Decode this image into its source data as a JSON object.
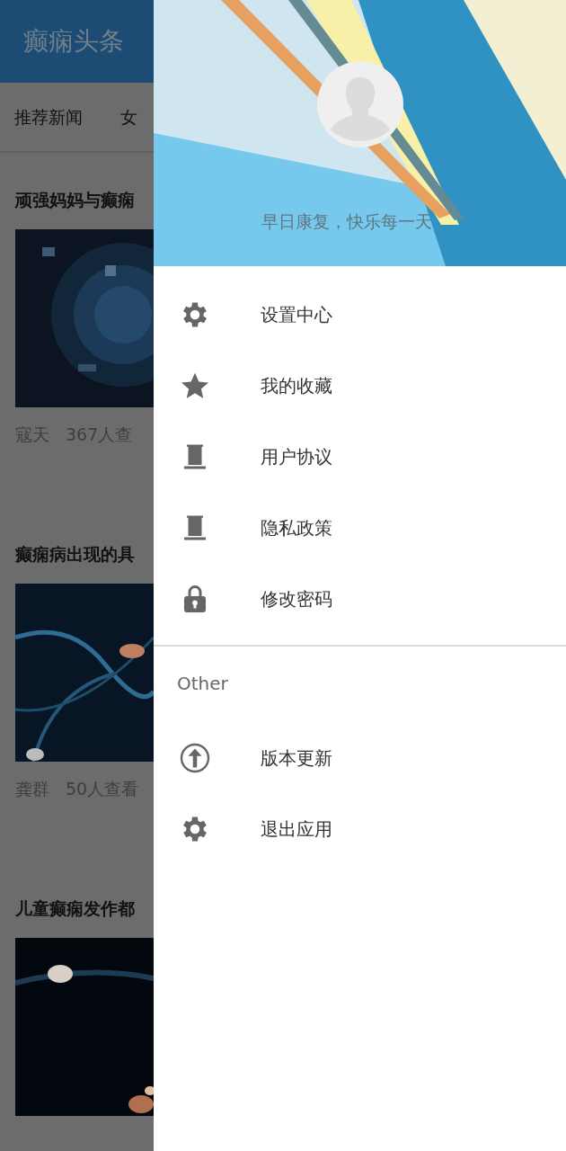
{
  "app_bar": {
    "title": "癫痫头条"
  },
  "tabs": [
    {
      "label": "推荐新闻"
    },
    {
      "label": "女"
    }
  ],
  "articles": [
    {
      "title": "顽强妈妈与癫痫",
      "author": "寇天",
      "views": "367人查"
    },
    {
      "title": "癫痫病出现的具",
      "author": "龚群",
      "views": "50人查看"
    },
    {
      "title": "儿童癫痫发作都"
    }
  ],
  "drawer": {
    "header": {
      "motto": "早日康复，快乐每一天"
    },
    "items": [
      {
        "label": "设置中心"
      },
      {
        "label": "我的收藏"
      },
      {
        "label": "用户协议"
      },
      {
        "label": "隐私政策"
      },
      {
        "label": "修改密码"
      }
    ],
    "section_title": "Other",
    "other_items": [
      {
        "label": "版本更新"
      },
      {
        "label": "退出应用"
      }
    ]
  }
}
